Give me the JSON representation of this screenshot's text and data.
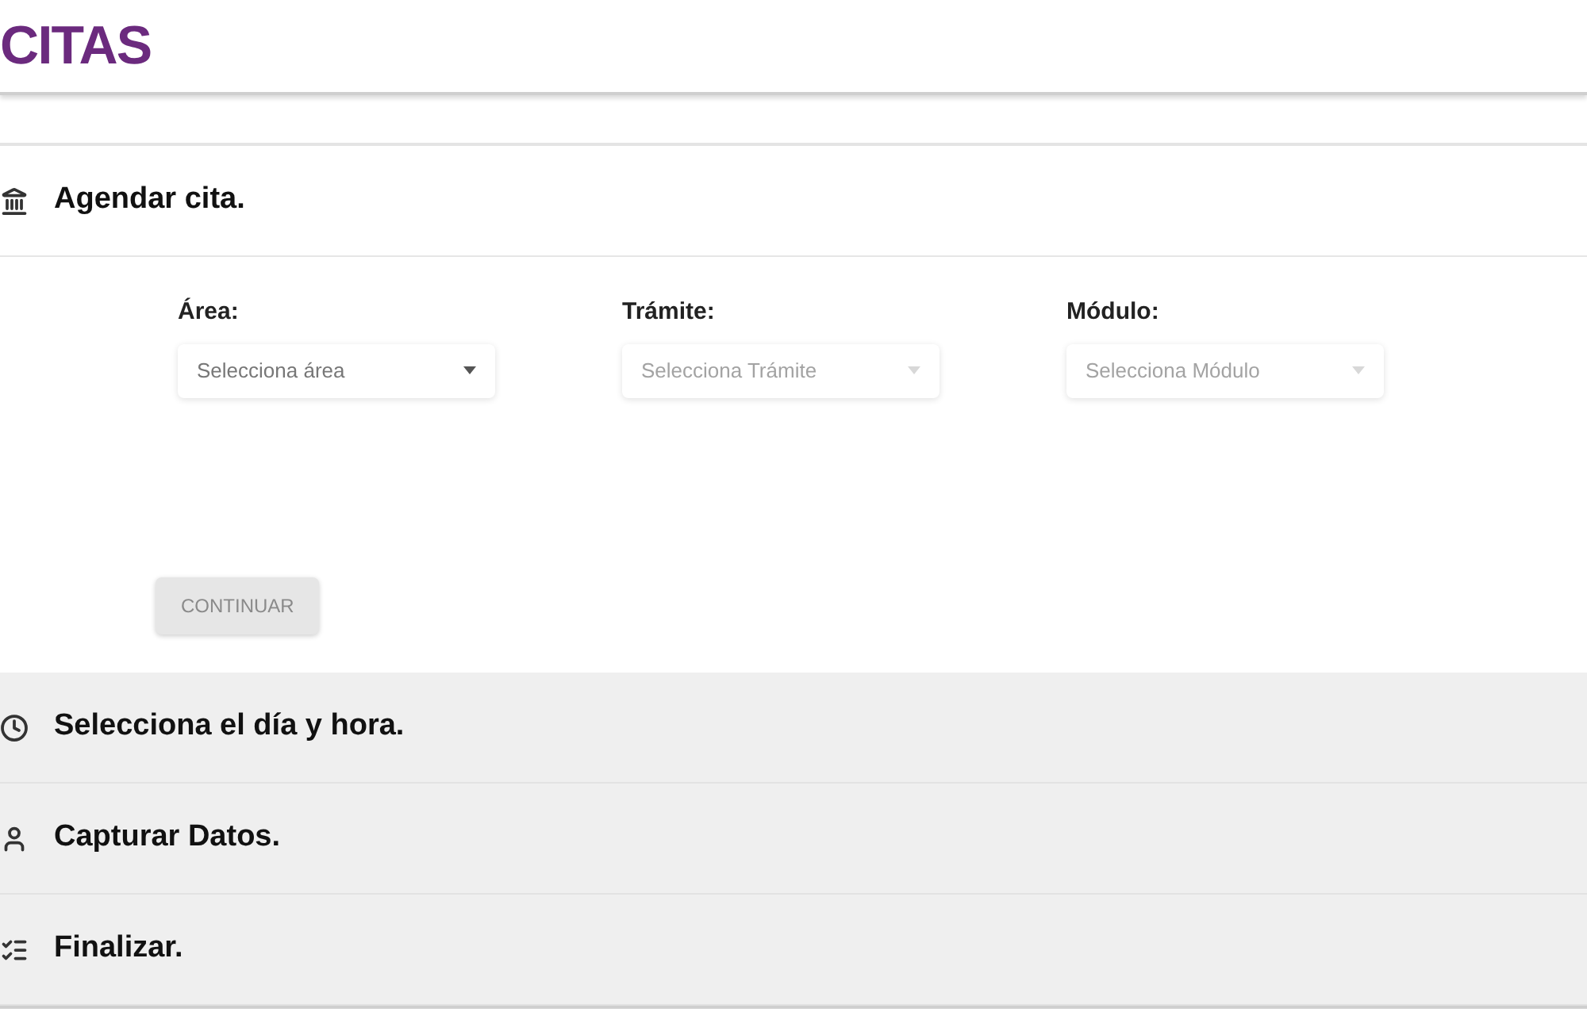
{
  "header": {
    "title": "CITAS"
  },
  "steps": [
    {
      "kind": "bank",
      "title": "Agendar cita.",
      "expanded": true
    },
    {
      "kind": "clock",
      "title": "Selecciona el día y hora.",
      "expanded": false
    },
    {
      "kind": "user",
      "title": "Capturar Datos.",
      "expanded": false
    },
    {
      "kind": "check",
      "title": "Finalizar.",
      "expanded": false
    }
  ],
  "form": {
    "fields": [
      {
        "label": "Área:",
        "placeholder": "Selecciona área",
        "disabled": false
      },
      {
        "label": "Trámite:",
        "placeholder": "Selecciona Trámite",
        "disabled": true
      },
      {
        "label": "Módulo:",
        "placeholder": "Selecciona Módulo",
        "disabled": true
      }
    ],
    "button": {
      "label": "CONTINUAR",
      "disabled": true
    }
  }
}
